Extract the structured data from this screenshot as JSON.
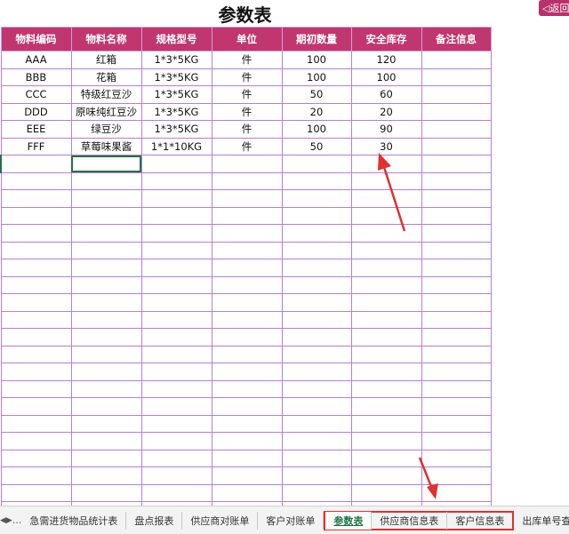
{
  "title": "参数表",
  "back_button": "◁返回",
  "headers": [
    "物料编码",
    "物料名称",
    "规格型号",
    "单位",
    "期初数量",
    "安全库存",
    "备注信息"
  ],
  "rows": [
    [
      "AAA",
      "红箱",
      "1*3*5KG",
      "件",
      "100",
      "120",
      ""
    ],
    [
      "BBB",
      "花箱",
      "1*3*5KG",
      "件",
      "100",
      "100",
      ""
    ],
    [
      "CCC",
      "特级红豆沙",
      "1*3*5KG",
      "件",
      "50",
      "60",
      ""
    ],
    [
      "DDD",
      "原味纯红豆沙",
      "1*3*5KG",
      "件",
      "20",
      "20",
      ""
    ],
    [
      "EEE",
      "绿豆沙",
      "1*3*5KG",
      "件",
      "100",
      "90",
      ""
    ],
    [
      "FFF",
      "草莓味果酱",
      "1*1*10KG",
      "件",
      "50",
      "30",
      ""
    ]
  ],
  "sheet_tabs": {
    "nav_prev": "◀",
    "nav_next": "▶",
    "nav_more": "...",
    "before": [
      "急需进货物品统计表",
      "盘点报表",
      "供应商对账单",
      "客户对账单"
    ],
    "highlighted": [
      "参数表",
      "供应商信息表",
      "客户信息表"
    ],
    "after": [
      "出库单号查询"
    ],
    "active": "参数表"
  },
  "colors": {
    "header_bg": "#c0376f",
    "grid_line": "#b57fd1",
    "selection": "#217346",
    "annotation_red": "#e03030"
  }
}
